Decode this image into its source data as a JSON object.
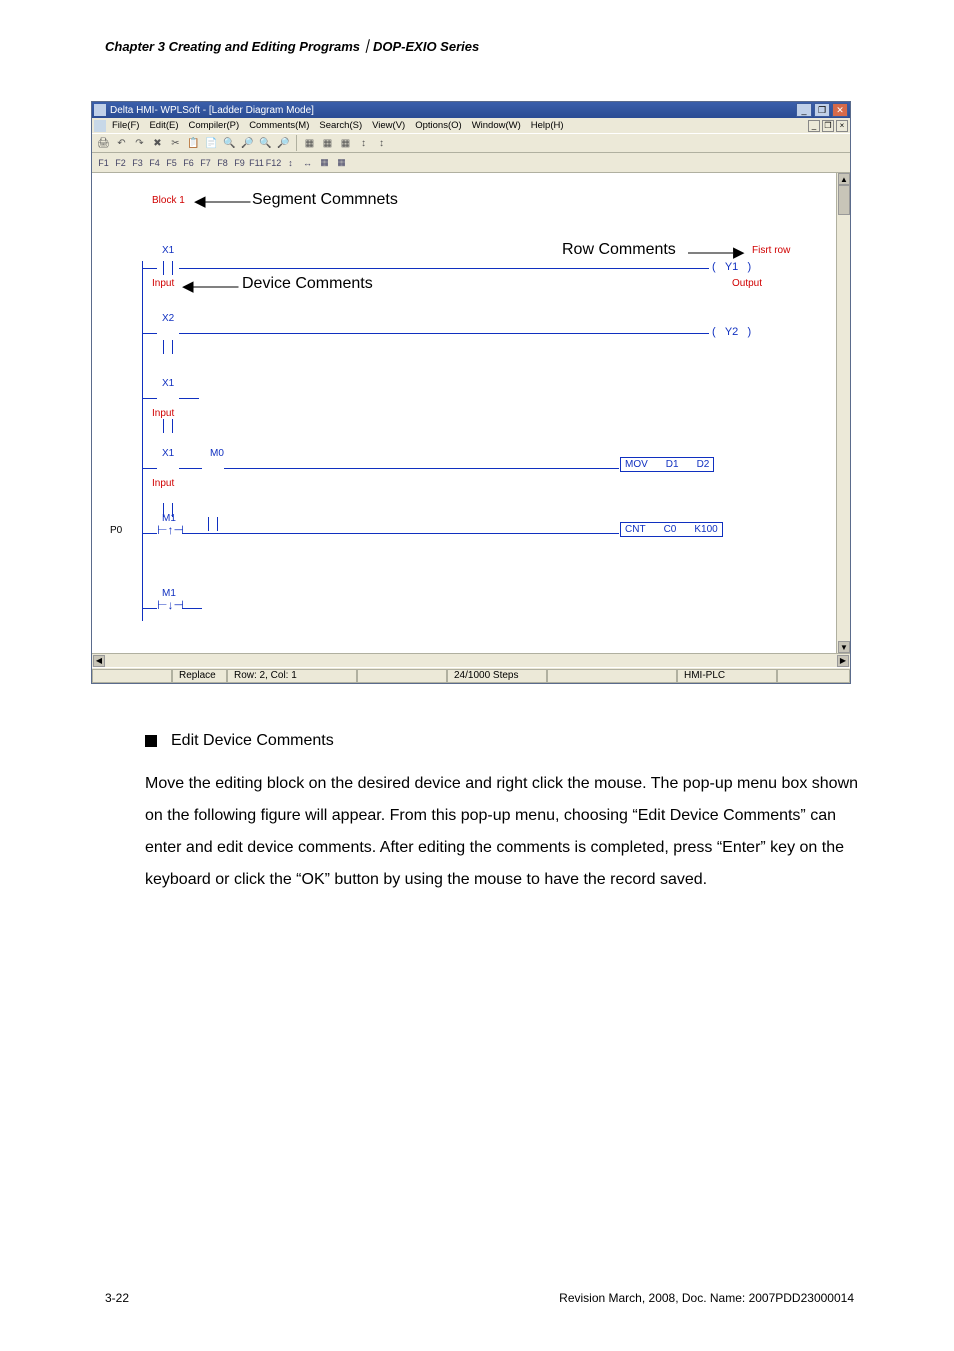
{
  "chapter_heading": "Chapter 3 Creating and Editing Programs｜DOP-EXIO Series",
  "window": {
    "title": "Delta HMI- WPLSoft - [Ladder Diagram Mode]",
    "sysbuttons": {
      "min": "_",
      "max": "❐",
      "close": "✕"
    }
  },
  "menus": [
    "File(F)",
    "Edit(E)",
    "Compiler(P)",
    "Comments(M)",
    "Search(S)",
    "View(V)",
    "Options(O)",
    "Window(W)",
    "Help(H)"
  ],
  "mdi_buttons": [
    "_",
    "❐",
    "×"
  ],
  "toolbar1_glyphs": [
    "🖨",
    "↶",
    "↷",
    "✖",
    "✂",
    "📋",
    "📄",
    "🔍",
    "🔎",
    "🔍",
    "🔎",
    "|",
    "▦",
    "▦",
    "▦",
    "↕",
    "↕"
  ],
  "toolbar2_labels": [
    "F1",
    "F2",
    "F3",
    "F4",
    "F5",
    "F6",
    "F7",
    "F8",
    "F9",
    "F11",
    "F12",
    "↕",
    "↔",
    "▦",
    "▦"
  ],
  "annotations": {
    "block": "Block 1",
    "segment": "Segment Commnets",
    "rowcomments": "Row Comments",
    "devicecomments": "Device Comments",
    "firstrow": "Fisrt row",
    "input": "Input",
    "output": "Output"
  },
  "ladder": {
    "x1": "X1",
    "x2": "X2",
    "m0": "M0",
    "m1": "M1",
    "p0": "P0",
    "y1": "Y1",
    "y2": "Y2",
    "mov": {
      "op": "MOV",
      "a": "D1",
      "b": "D2"
    },
    "cnt": {
      "op": "CNT",
      "a": "C0",
      "b": "K100"
    }
  },
  "status": {
    "mode": "Replace",
    "pos": "Row: 2, Col: 1",
    "steps": "24/1000 Steps",
    "target": "HMI-PLC"
  },
  "body": {
    "heading": "Edit Device Comments",
    "paragraph": "Move the editing block on the desired device and right click the mouse. The pop-up menu box shown on the following figure will appear. From this pop-up menu, choosing “Edit Device Comments” can enter and edit device comments. After editing the comments is completed, press “Enter” key on the keyboard or click the “OK” button by using the mouse to have the record saved."
  },
  "footer": {
    "page": "3-22",
    "rev": "Revision March, 2008, Doc. Name: 2007PDD23000014"
  }
}
